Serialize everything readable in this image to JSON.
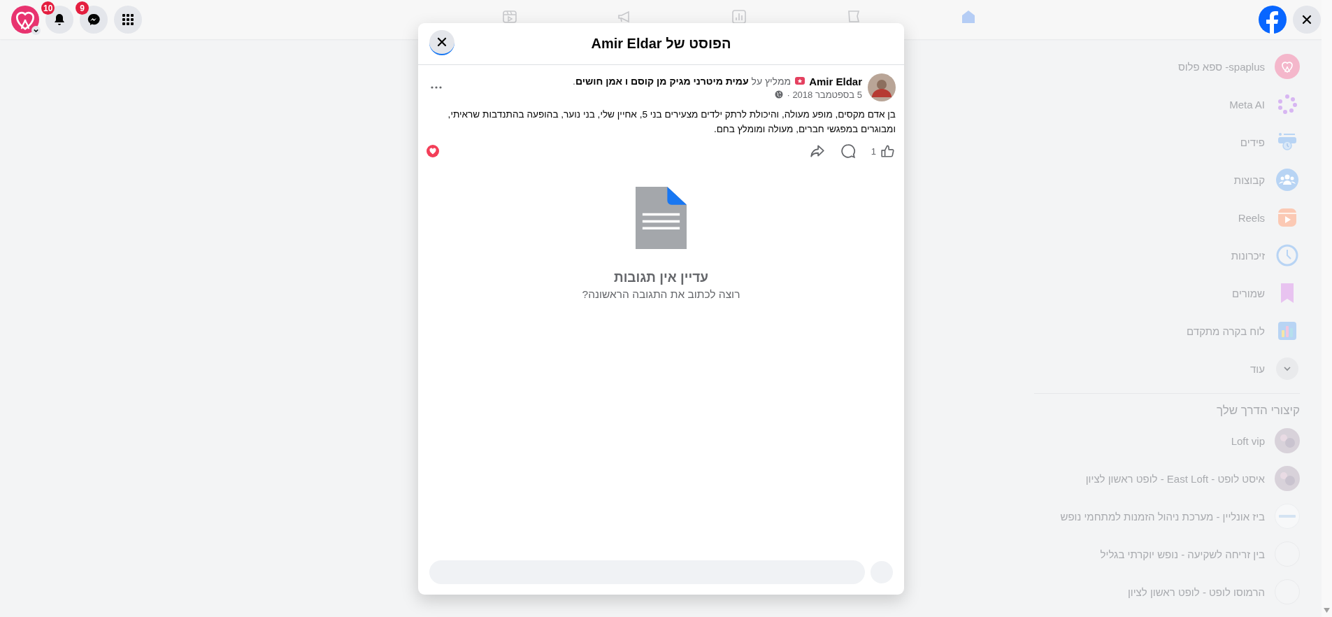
{
  "top_bar": {
    "notifications_badge": "10",
    "messages_badge": "9"
  },
  "nav": [
    {
      "kind": "home",
      "selected": true
    },
    {
      "kind": "flag",
      "selected": false
    },
    {
      "kind": "chart",
      "selected": false
    },
    {
      "kind": "megaphone",
      "selected": false
    },
    {
      "kind": "reels",
      "selected": false
    }
  ],
  "modal": {
    "title": "הפוסט של Amir Eldar",
    "post": {
      "author": "Amir Eldar",
      "recommendation": "ממליץ על **עמית מיטרני מגיק מן קוסם ו אמן חושים**.",
      "date": "5 בספטמבר 2018 ·",
      "text": "בן אדם מקסים, מופע מעולה, והיכולת לרתק ילדים מצעירים בני 5, אחיין שלי, בני נוער, בהופעה בהתנדבות שראיתי, ומבוגרים במפגשי חברים, מעולה ומומלץ בחם.",
      "like_count": "1"
    },
    "empty_comments": {
      "title": "עדיין אין תגובות",
      "subtitle": "רוצה לכתוב את התגובה הראשונה?"
    }
  },
  "sidebar": {
    "items": [
      {
        "kind": "profile",
        "label": "spaplus- ספא פלוס"
      },
      {
        "kind": "meta-ai",
        "label": "Meta AI"
      },
      {
        "kind": "feeds",
        "label": "פידים"
      },
      {
        "kind": "groups",
        "label": "קבוצות"
      },
      {
        "kind": "reels",
        "label": "Reels"
      },
      {
        "kind": "memories",
        "label": "זיכרונות"
      },
      {
        "kind": "saved",
        "label": "שמורים"
      },
      {
        "kind": "dashboard",
        "label": "לוח בקרה מתקדם"
      },
      {
        "kind": "more",
        "label": "עוד"
      }
    ],
    "shortcuts_header": "קיצורי הדרך שלך",
    "shortcuts": [
      {
        "kind": "photo",
        "label": "Loft vip"
      },
      {
        "kind": "photo",
        "label": "איסט לופט - East Loft - לופט ראשון לציון"
      },
      {
        "kind": "logo",
        "label": "ביז אונליין - מערכת ניהול הזמנות למתחמי נופש"
      },
      {
        "kind": "blank",
        "label": "בין זריחה לשקיעה - נופש יוקרתי בגליל"
      },
      {
        "kind": "blank",
        "label": "הרמוסו לופט - לופט ראשון לציון"
      }
    ]
  }
}
